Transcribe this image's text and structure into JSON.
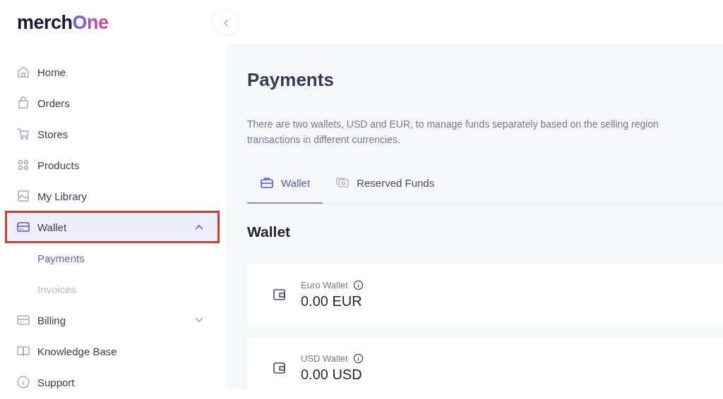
{
  "logo": {
    "first": "merch",
    "second": "One"
  },
  "sidebar": {
    "items": [
      {
        "label": "Home",
        "selected": false,
        "highlighted": false
      },
      {
        "label": "Orders",
        "selected": false,
        "highlighted": false
      },
      {
        "label": "Stores",
        "selected": false,
        "highlighted": false
      },
      {
        "label": "Products",
        "selected": false,
        "highlighted": false
      },
      {
        "label": "My Library",
        "selected": false,
        "highlighted": false
      },
      {
        "label": "Wallet",
        "selected": true,
        "highlighted": true,
        "expanded": true,
        "children": [
          {
            "label": "Payments",
            "selected": true
          },
          {
            "label": "Invoices",
            "selected": false
          }
        ]
      },
      {
        "label": "Billing",
        "selected": false,
        "highlighted": false,
        "expanded": false
      },
      {
        "label": "Knowledge Base",
        "selected": false,
        "highlighted": false
      },
      {
        "label": "Support",
        "selected": false,
        "highlighted": false
      }
    ]
  },
  "page": {
    "title": "Payments",
    "description": "There are two wallets, USD and EUR, to manage funds separately based on the selling region",
    "description_2": "transactions in different currencies.",
    "tabs": [
      {
        "label": "Wallet",
        "selected": true
      },
      {
        "label": "Reserved Funds",
        "selected": false
      }
    ],
    "section_title": "Wallet",
    "wallets": [
      {
        "label": "Euro Wallet",
        "amount": "0.00 EUR"
      },
      {
        "label": "USD Wallet",
        "amount": "0.00 USD"
      }
    ]
  }
}
